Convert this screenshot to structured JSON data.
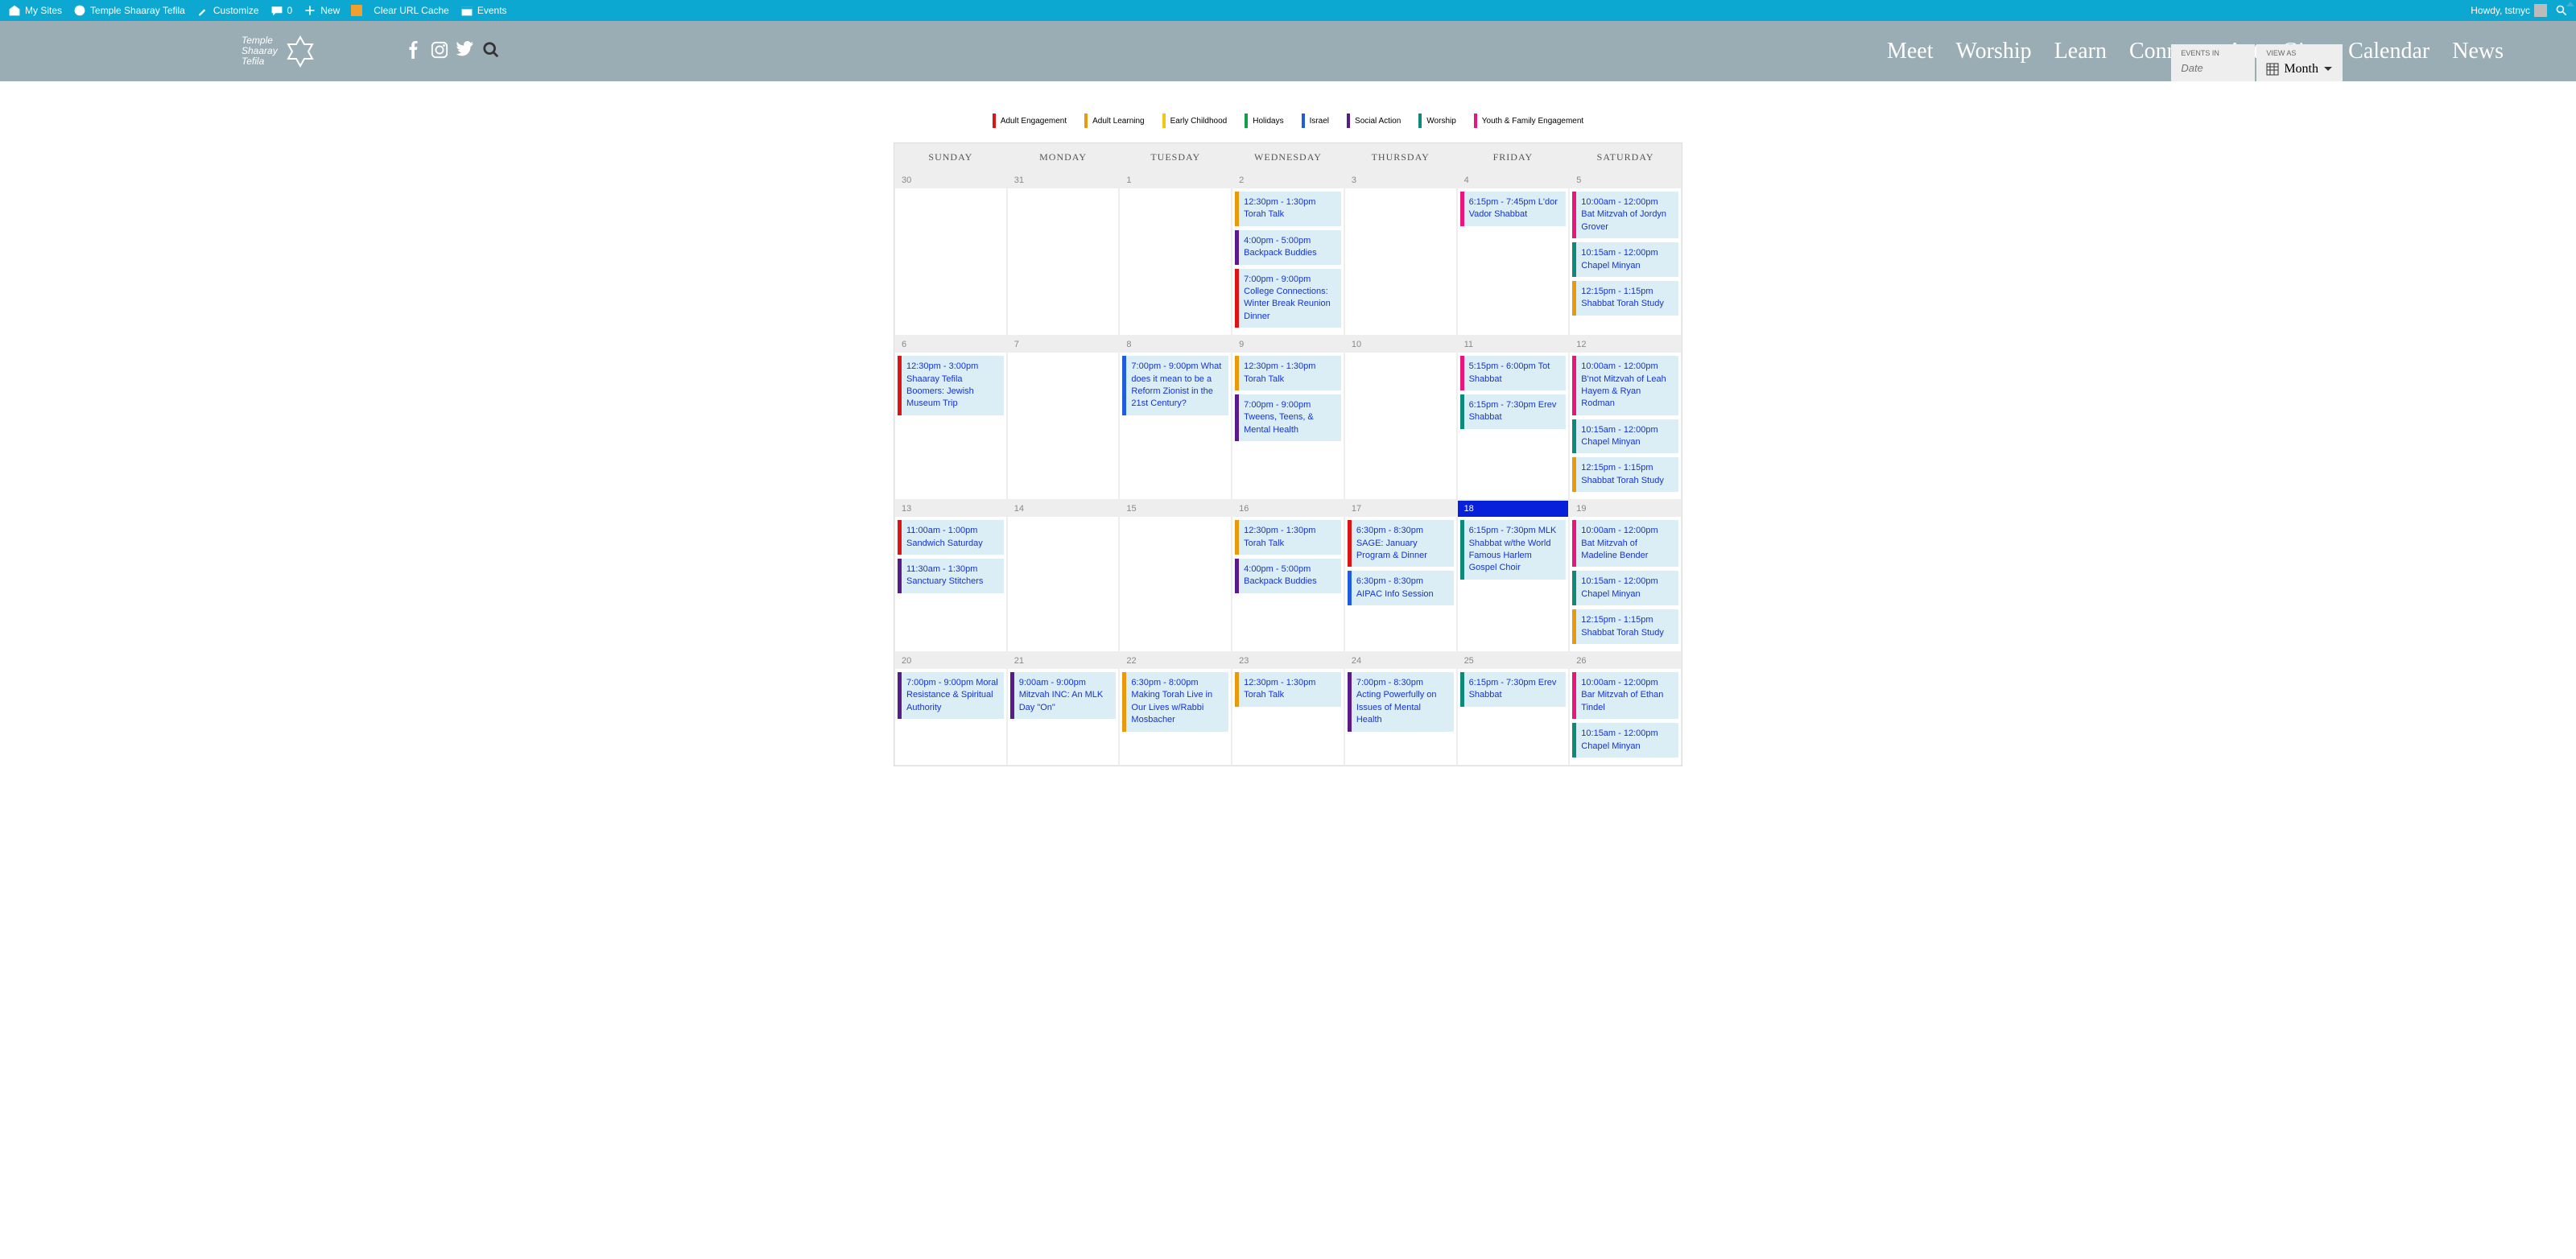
{
  "adminBar": {
    "mySites": "My Sites",
    "siteName": "Temple Shaaray Tefila",
    "customize": "Customize",
    "comments": "0",
    "new": "New",
    "clearCache": "Clear URL Cache",
    "events": "Events",
    "howdy": "Howdy, tstnyc"
  },
  "nav": [
    "Meet",
    "Worship",
    "Learn",
    "Connect",
    "Act",
    "Give",
    "Calendar",
    "News"
  ],
  "controls": {
    "eventsInLabel": "EVENTS IN",
    "datePlaceholder": "Date",
    "viewAsLabel": "VIEW AS",
    "viewValue": "Month"
  },
  "legend": [
    {
      "label": "Adult Engagement",
      "c": "c-red"
    },
    {
      "label": "Adult Learning",
      "c": "c-orange"
    },
    {
      "label": "Early Childhood",
      "c": "c-yellow"
    },
    {
      "label": "Holidays",
      "c": "c-green"
    },
    {
      "label": "Israel",
      "c": "c-blue"
    },
    {
      "label": "Social Action",
      "c": "c-purple"
    },
    {
      "label": "Worship",
      "c": "c-teal"
    },
    {
      "label": "Youth & Family Engagement",
      "c": "c-pink"
    }
  ],
  "dayHeaders": [
    "SUNDAY",
    "MONDAY",
    "TUESDAY",
    "WEDNESDAY",
    "THURSDAY",
    "FRIDAY",
    "SATURDAY"
  ],
  "weeks": [
    {
      "days": [
        {
          "num": "30",
          "events": []
        },
        {
          "num": "31",
          "events": []
        },
        {
          "num": "1",
          "events": []
        },
        {
          "num": "2",
          "events": [
            {
              "c": "c-orange",
              "t": "12:30pm - 1:30pm Torah Talk"
            },
            {
              "c": "c-purple",
              "t": "4:00pm - 5:00pm Backpack Buddies"
            },
            {
              "c": "c-red",
              "t": "7:00pm - 9:00pm College Connections: Winter Break Reunion Dinner"
            }
          ]
        },
        {
          "num": "3",
          "events": []
        },
        {
          "num": "4",
          "events": [
            {
              "c": "c-pink",
              "t": "6:15pm - 7:45pm L'dor Vador Shabbat"
            }
          ]
        },
        {
          "num": "5",
          "events": [
            {
              "c": "c-pink",
              "t": "10:00am - 12:00pm Bat Mitzvah of Jordyn Grover"
            },
            {
              "c": "c-teal",
              "t": "10:15am - 12:00pm Chapel Minyan"
            },
            {
              "c": "c-orange",
              "t": "12:15pm - 1:15pm Shabbat Torah Study"
            }
          ]
        }
      ]
    },
    {
      "days": [
        {
          "num": "6",
          "events": [
            {
              "c": "c-red",
              "t": "12:30pm - 3:00pm Shaaray Tefila Boomers: Jewish Museum Trip"
            }
          ]
        },
        {
          "num": "7",
          "events": []
        },
        {
          "num": "8",
          "events": [
            {
              "c": "c-blue",
              "t": "7:00pm - 9:00pm What does it mean to be a Reform Zionist in the 21st Century?"
            }
          ]
        },
        {
          "num": "9",
          "events": [
            {
              "c": "c-orange",
              "t": "12:30pm - 1:30pm Torah Talk"
            },
            {
              "c": "c-purple",
              "t": "7:00pm - 9:00pm Tweens, Teens, & Mental Health"
            }
          ]
        },
        {
          "num": "10",
          "events": []
        },
        {
          "num": "11",
          "events": [
            {
              "c": "c-pink",
              "t": "5:15pm - 6:00pm Tot Shabbat"
            },
            {
              "c": "c-teal",
              "t": "6:15pm - 7:30pm Erev Shabbat"
            }
          ]
        },
        {
          "num": "12",
          "events": [
            {
              "c": "c-pink",
              "t": "10:00am - 12:00pm B'not Mitzvah of Leah Hayem & Ryan Rodman"
            },
            {
              "c": "c-teal",
              "t": "10:15am - 12:00pm Chapel Minyan"
            },
            {
              "c": "c-orange",
              "t": "12:15pm - 1:15pm Shabbat Torah Study"
            }
          ]
        }
      ]
    },
    {
      "days": [
        {
          "num": "13",
          "events": [
            {
              "c": "c-red",
              "t": "11:00am - 1:00pm Sandwich Saturday"
            },
            {
              "c": "c-purple",
              "t": "11:30am - 1:30pm Sanctuary Stitchers"
            }
          ]
        },
        {
          "num": "14",
          "events": []
        },
        {
          "num": "15",
          "events": []
        },
        {
          "num": "16",
          "events": [
            {
              "c": "c-orange",
              "t": "12:30pm - 1:30pm Torah Talk"
            },
            {
              "c": "c-purple",
              "t": "4:00pm - 5:00pm Backpack Buddies"
            }
          ]
        },
        {
          "num": "17",
          "events": [
            {
              "c": "c-red",
              "t": "6:30pm - 8:30pm SAGE: January Program & Dinner"
            },
            {
              "c": "c-blue",
              "t": "6:30pm - 8:30pm AIPAC Info Session"
            }
          ]
        },
        {
          "num": "18",
          "today": true,
          "events": [
            {
              "c": "c-teal",
              "t": "6:15pm - 7:30pm MLK Shabbat w/the World Famous Harlem Gospel Choir"
            }
          ]
        },
        {
          "num": "19",
          "events": [
            {
              "c": "c-pink",
              "t": "10:00am - 12:00pm Bat Mitzvah of Madeline Bender"
            },
            {
              "c": "c-teal",
              "t": "10:15am - 12:00pm Chapel Minyan"
            },
            {
              "c": "c-orange",
              "t": "12:15pm - 1:15pm Shabbat Torah Study"
            }
          ]
        }
      ]
    },
    {
      "days": [
        {
          "num": "20",
          "events": [
            {
              "c": "c-purple",
              "t": "7:00pm - 9:00pm Moral Resistance & Spiritual Authority"
            }
          ]
        },
        {
          "num": "21",
          "events": [
            {
              "c": "c-purple",
              "t": "9:00am - 9:00pm Mitzvah INC: An MLK Day \"On\""
            }
          ]
        },
        {
          "num": "22",
          "events": [
            {
              "c": "c-orange",
              "t": "6:30pm - 8:00pm Making Torah Live in Our Lives w/Rabbi Mosbacher"
            }
          ]
        },
        {
          "num": "23",
          "events": [
            {
              "c": "c-orange",
              "t": "12:30pm - 1:30pm Torah Talk"
            }
          ]
        },
        {
          "num": "24",
          "events": [
            {
              "c": "c-purple",
              "t": "7:00pm - 8:30pm Acting Powerfully on Issues of Mental Health"
            }
          ]
        },
        {
          "num": "25",
          "events": [
            {
              "c": "c-teal",
              "t": "6:15pm - 7:30pm Erev Shabbat"
            }
          ]
        },
        {
          "num": "26",
          "events": [
            {
              "c": "c-pink",
              "t": "10:00am - 12:00pm Bar Mitzvah of Ethan Tindel"
            },
            {
              "c": "c-teal",
              "t": "10:15am - 12:00pm Chapel Minyan"
            }
          ]
        }
      ]
    }
  ]
}
